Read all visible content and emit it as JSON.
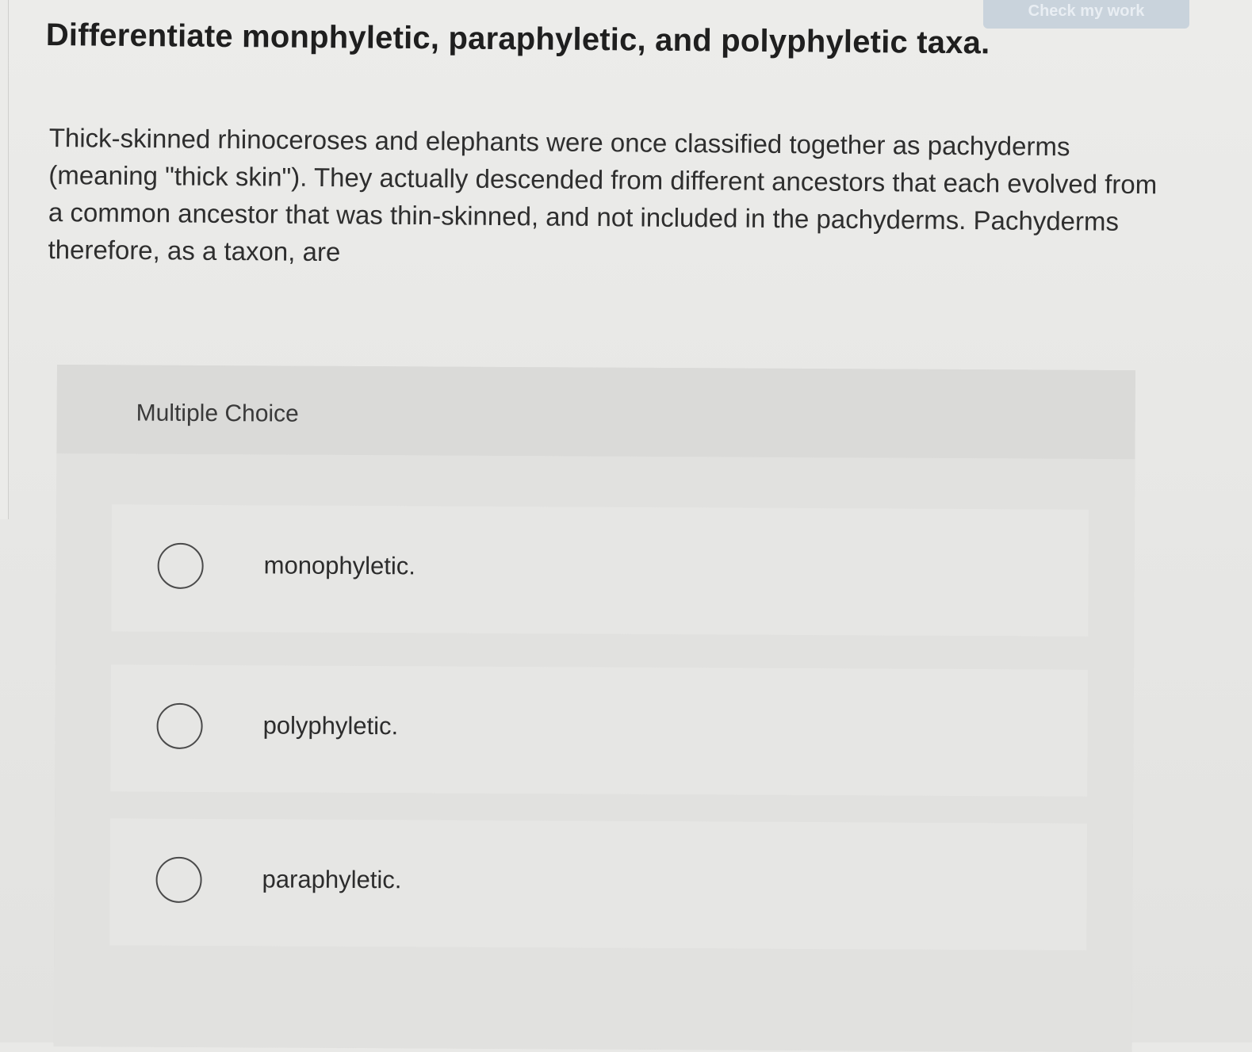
{
  "header": {
    "check_button_label": "Check my work",
    "title": "Differentiate monphyletic, paraphyletic, and polyphyletic taxa."
  },
  "question": {
    "prompt": "Thick-skinned rhinoceroses and elephants were once classified together as pachyderms (meaning \"thick skin\"). They actually descended from different ancestors that each evolved from a common ancestor that was thin-skinned, and not included in the pachyderms. Pachyderms therefore, as a taxon, are"
  },
  "choices": {
    "header_label": "Multiple Choice",
    "options": [
      {
        "label": "monophyletic.",
        "selected": false
      },
      {
        "label": "polyphyletic.",
        "selected": false
      },
      {
        "label": "paraphyletic.",
        "selected": false
      }
    ]
  }
}
